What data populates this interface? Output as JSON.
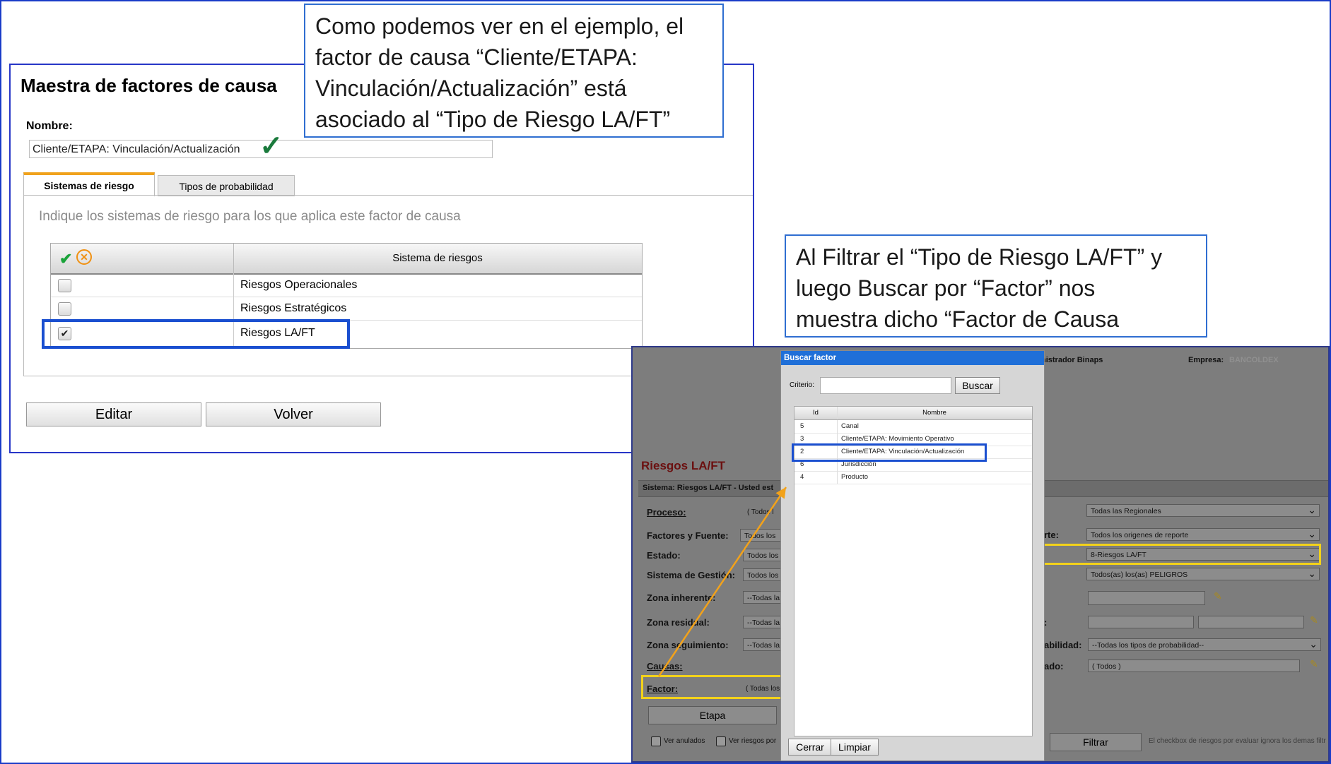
{
  "callout_top": {
    "lines": [
      "Como podemos ver en el ejemplo, el",
      "factor de causa “Cliente/ETAPA:",
      "Vinculación/Actualización” está",
      "asociado al “Tipo de Riesgo LA/FT”"
    ]
  },
  "callout_right": {
    "lines": [
      "Al Filtrar el “Tipo de Riesgo LA/FT” y",
      "luego Buscar por “Factor” nos",
      "muestra dicho “Factor de Causa"
    ]
  },
  "master": {
    "title": "Maestra de factores de causa",
    "name_label": "Nombre:",
    "name_value": "Cliente/ETAPA: Vinculación/Actualización",
    "tabs": [
      "Sistemas de riesgo",
      "Tipos de probabilidad"
    ],
    "hint": "Indique los sistemas de riesgo para los que aplica este factor de causa",
    "table_header": "Sistema de riesgos",
    "rows": [
      {
        "label": "Riesgos Operacionales",
        "checked": false
      },
      {
        "label": "Riesgos Estratégicos",
        "checked": false
      },
      {
        "label": "Riesgos LA/FT",
        "checked": true
      }
    ],
    "buttons": {
      "edit": "Editar",
      "back": "Volver"
    }
  },
  "background_app": {
    "admin_text": "nistrador Binaps",
    "empresa_label": "Empresa:",
    "empresa_value": "BANCOLDEX",
    "section_title": "Riesgos LA/FT",
    "system_bar": "Sistema: Riesgos LA/FT - Usted est",
    "filters_left": [
      {
        "label": "Proceso:",
        "value": "( Todos l"
      },
      {
        "label": "Factores y Fuente:",
        "value": "Todos los"
      },
      {
        "label": "Estado:",
        "value": "Todos los"
      },
      {
        "label": "Sistema de Gestión:",
        "value": "Todos los"
      },
      {
        "label": "Zona inherente:",
        "value": "--Todas la"
      },
      {
        "label": "Zona residual:",
        "value": "--Todas la"
      },
      {
        "label": "Zona seguimiento:",
        "value": "--Todas la"
      },
      {
        "label": "Causas:",
        "value": ""
      },
      {
        "label": "Factor:",
        "value": "( Todas los"
      }
    ],
    "filters_right": [
      {
        "label": "",
        "value": "Todas las Regionales"
      },
      {
        "label": "rte:",
        "value": "Todos los origenes de reporte"
      },
      {
        "label": "",
        "value": "8-Riesgos LA/FT"
      },
      {
        "label": "",
        "value": "Todos(as) los(as) PELIGROS"
      },
      {
        "label": "",
        "value": ""
      },
      {
        "label": ":",
        "value": ""
      },
      {
        "label": "abilidad:",
        "value": "--Todas los tipos de probabilidad--"
      },
      {
        "label": "ado:",
        "value": "( Todos )"
      }
    ],
    "etapa_button": "Etapa",
    "ver_anulados": "Ver anulados",
    "ver_riesgos": "Ver riesgos por",
    "filtrar_button": "Filtrar",
    "footer_note": "El checkbox de riesgos por evaluar ignora los demas filtr"
  },
  "modal": {
    "title": "Buscar factor",
    "criterio_label": "Criterio:",
    "search_button": "Buscar",
    "columns": [
      "Id",
      "Nombre"
    ],
    "rows": [
      {
        "id": "5",
        "name": "Canal"
      },
      {
        "id": "3",
        "name": "Cliente/ETAPA: Movimiento Operativo"
      },
      {
        "id": "2",
        "name": "Cliente/ETAPA: Vinculación/Actualización"
      },
      {
        "id": "6",
        "name": "Jurisdicción"
      },
      {
        "id": "4",
        "name": "Producto"
      }
    ],
    "close_button": "Cerrar",
    "clear_button": "Limpiar"
  },
  "colors": {
    "callout_border": "#2f6ed1",
    "highlight_blue": "#1a4fd0",
    "highlight_yellow": "#f3d21a",
    "arrow": "#f2a21a",
    "tab_accent": "#f0a21c",
    "modal_title_bg": "#1f6fd8"
  },
  "icons": [
    "check-all-icon",
    "uncheck-all-icon",
    "checkmark-icon",
    "chevron-down-icon",
    "pencil-icon",
    "arrow-icon"
  ]
}
